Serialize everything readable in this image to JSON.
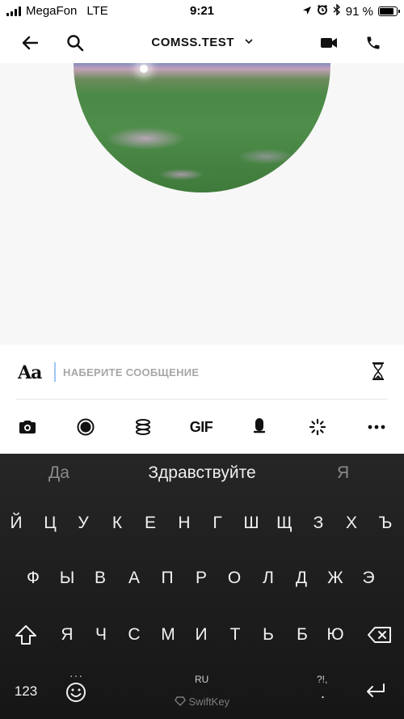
{
  "status_bar": {
    "carrier": "MegaFon",
    "network": "LTE",
    "time": "9:21",
    "battery_percent": "91 %",
    "battery_level": 0.91,
    "icons": [
      "signal-icon",
      "location-arrow-icon",
      "alarm-icon",
      "bluetooth-icon",
      "battery-icon"
    ]
  },
  "header": {
    "title": "COMSS.TEST",
    "icons": [
      "back-arrow-icon",
      "search-icon",
      "chevron-down-icon",
      "video-call-icon",
      "phone-call-icon"
    ]
  },
  "composer": {
    "format_label": "Aa",
    "placeholder": "НАБЕРИТЕ СООБЩЕНИЕ",
    "value": "",
    "tools": {
      "camera": "camera-icon",
      "record": "record-icon",
      "stickers": "spiral-icon",
      "gif_label": "GIF",
      "mic": "microphone-icon",
      "effects": "sparkle-icon",
      "more": "more-icon"
    }
  },
  "keyboard": {
    "suggestions": [
      "Да",
      "Здравствуйте",
      "Я"
    ],
    "rows": [
      [
        "Й",
        "Ц",
        "У",
        "К",
        "Е",
        "Н",
        "Г",
        "Ш",
        "Щ",
        "З",
        "Х",
        "Ъ"
      ],
      [
        "Ф",
        "Ы",
        "В",
        "А",
        "П",
        "Р",
        "О",
        "Л",
        "Д",
        "Ж",
        "Э"
      ],
      [
        "Я",
        "Ч",
        "С",
        "М",
        "И",
        "Т",
        "Ь",
        "Б",
        "Ю"
      ]
    ],
    "numbers_label": "123",
    "language": "RU",
    "punct_label": "?!,",
    "punct_dot": ".",
    "emoji_dots": "···",
    "brand": "SwiftKey"
  },
  "colors": {
    "caret": "#9ec6f2",
    "keyboard_bg": "#1c1c1c",
    "placeholder": "#a7a7a7"
  }
}
